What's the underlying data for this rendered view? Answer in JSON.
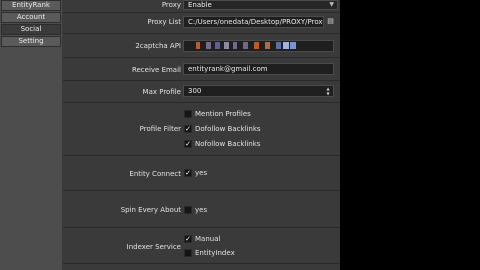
{
  "sidebar": {
    "items": [
      {
        "label": "EntityRank",
        "active": false
      },
      {
        "label": "Account",
        "active": false
      },
      {
        "label": "Social",
        "active": true
      },
      {
        "label": "Setting",
        "active": false
      }
    ]
  },
  "form": {
    "proxy": {
      "label": "Proxy",
      "value": "Enable"
    },
    "proxy_list": {
      "label": "Proxy List",
      "value": "C:/Users/onedata/Desktop/PROXY/Proxy.txt"
    },
    "captcha": {
      "label": "2captcha API"
    },
    "receive_email": {
      "label": "Receive Email",
      "value": "entityrank@gmail.com"
    },
    "max_profile": {
      "label": "Max Profile",
      "value": "300"
    },
    "profile_filter": {
      "label": "Profile Filter",
      "options": [
        {
          "label": "Mention Profiles",
          "checked": false
        },
        {
          "label": "Dofollow Backlinks",
          "checked": true
        },
        {
          "label": "Nofollow Backlinks",
          "checked": true
        }
      ]
    },
    "entity_connect": {
      "label": "Entity Connect",
      "option": {
        "label": "yes",
        "checked": true
      }
    },
    "spin_every_about": {
      "label": "Spin Every About",
      "option": {
        "label": "yes",
        "checked": false
      }
    },
    "indexer_service": {
      "label": "Indexer Service",
      "options": [
        {
          "label": "Manual",
          "checked": true
        },
        {
          "label": "EntityIndex",
          "checked": false
        }
      ]
    }
  },
  "icons": {
    "check": "✓",
    "folder": "folder-icon",
    "chevron": "chevron-down-icon"
  },
  "colors": {
    "panel": "#3a3a3a",
    "field_bg": "#1f1f1f",
    "sidebar": "#4d4d4d"
  }
}
